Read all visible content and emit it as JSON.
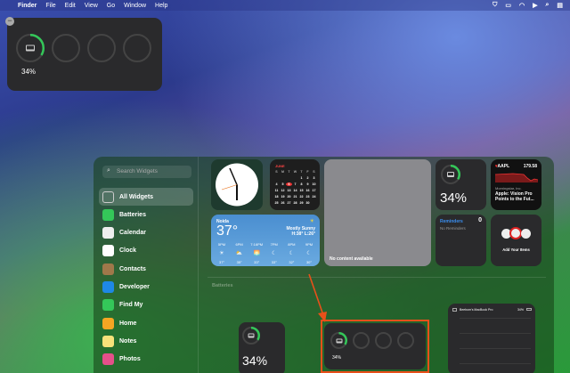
{
  "menubar": {
    "app": "Finder",
    "items": [
      "File",
      "Edit",
      "View",
      "Go",
      "Window",
      "Help"
    ]
  },
  "top_widget": {
    "percent": "34%"
  },
  "sidebar": {
    "search_placeholder": "Search Widgets",
    "items": [
      {
        "label": "All Widgets",
        "color": "#555"
      },
      {
        "label": "Batteries",
        "color": "#34c759"
      },
      {
        "label": "Calendar",
        "color": "#eee"
      },
      {
        "label": "Clock",
        "color": "#fff"
      },
      {
        "label": "Contacts",
        "color": "#a0784a"
      },
      {
        "label": "Developer",
        "color": "#1e88e5"
      },
      {
        "label": "Find My",
        "color": "#34c759"
      },
      {
        "label": "Home",
        "color": "#f5a623"
      },
      {
        "label": "Notes",
        "color": "#f7e27a"
      },
      {
        "label": "Photos",
        "color": "#e5508a"
      }
    ]
  },
  "calendar": {
    "month": "JUNE",
    "weekdays": [
      "S",
      "M",
      "T",
      "W",
      "T",
      "F",
      "S"
    ],
    "days": [
      "",
      "",
      "",
      "",
      "1",
      "2",
      "3",
      "4",
      "5",
      "6",
      "7",
      "8",
      "9",
      "10",
      "11",
      "12",
      "13",
      "14",
      "15",
      "16",
      "17",
      "18",
      "19",
      "20",
      "21",
      "22",
      "23",
      "24",
      "25",
      "26",
      "27",
      "28",
      "29",
      "30"
    ],
    "today": "6"
  },
  "weather": {
    "city": "Noida",
    "temp": "37°",
    "condition": "Mostly Sunny",
    "hilo": "H:38° L:26°",
    "hours": [
      {
        "t": "5PM",
        "i": "☀",
        "v": "37°"
      },
      {
        "t": "6PM",
        "i": "⛅",
        "v": "35°"
      },
      {
        "t": "7:16PM",
        "i": "🌅",
        "v": "33°"
      },
      {
        "t": "7PM",
        "i": "☾",
        "v": "33°"
      },
      {
        "t": "8PM",
        "i": "☾",
        "v": "32°"
      },
      {
        "t": "9PM",
        "i": "☾",
        "v": "30°"
      }
    ]
  },
  "photos_widget": {
    "text": "No content available"
  },
  "battery_small": {
    "percent": "34%"
  },
  "stocks": {
    "symbol": "AAPL",
    "price": "179.58",
    "source": "Morningstar, Inc.",
    "headline": "Apple: Vision Pro Points to the Fut..."
  },
  "reminders": {
    "title": "Reminders",
    "count": "0",
    "empty": "No Reminders"
  },
  "home_widget": {
    "text": "Add Your Items"
  },
  "section": {
    "title": "Batteries"
  },
  "batt_a": {
    "percent": "34%"
  },
  "batt_b": {
    "percent": "34%"
  },
  "batt_list": {
    "device": "Beebom's MacBook Pro",
    "percent": "34%"
  },
  "battery_level": 0.34,
  "accent": "#34c759",
  "highlight": "#e8501a"
}
